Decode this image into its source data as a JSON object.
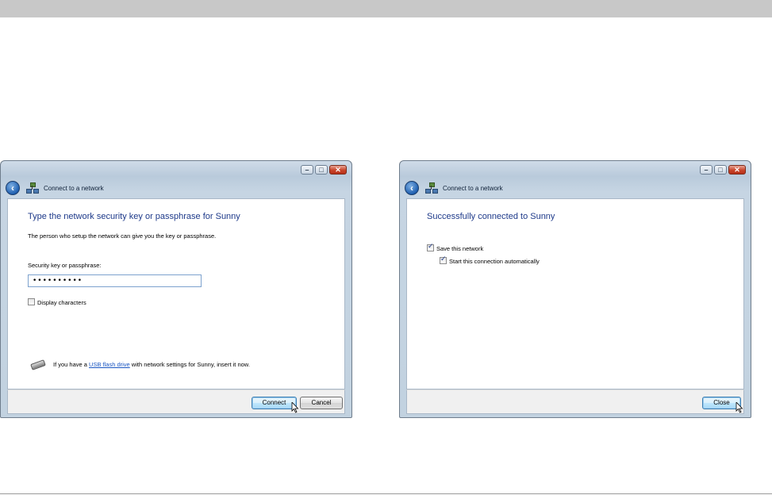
{
  "dialogs": {
    "security_key": {
      "title": "Connect to a network",
      "heading": "Type the network security key or passphrase for Sunny",
      "description": "The person who setup the network can give you the key or passphrase.",
      "field_label": "Security key or passphrase:",
      "field_value": "••••••••••",
      "display_characters_label": "Display characters",
      "display_characters_checked": false,
      "usb_prefix": "If you have a ",
      "usb_link": "USB flash drive",
      "usb_suffix": " with network settings for Sunny, insert it now.",
      "connect_label": "Connect",
      "cancel_label": "Cancel"
    },
    "success": {
      "title": "Connect to a network",
      "heading": "Successfully connected to Sunny",
      "save_network_label": "Save this network",
      "save_network_checked": true,
      "auto_start_label": "Start this connection automatically",
      "auto_start_checked": true,
      "close_label": "Close"
    }
  },
  "window_controls": {
    "minimize": "–",
    "maximize": "□",
    "close": "✕"
  },
  "colors": {
    "heading": "#1e3a8a",
    "link": "#1a56c2",
    "page_band": "#c8c8c8"
  },
  "icons": {
    "back": "back-arrow-icon",
    "network": "network-icon",
    "usb": "usb-drive-icon",
    "cursor": "mouse-pointer-icon"
  }
}
